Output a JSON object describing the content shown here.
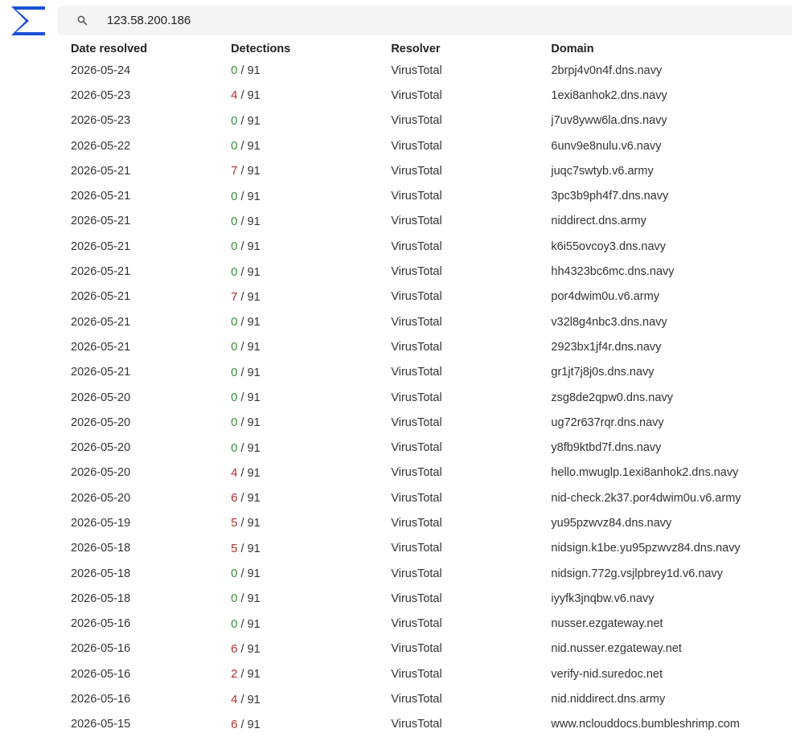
{
  "colors": {
    "accent": "#1a4fd6",
    "detections_clean": "#3d8f3d",
    "detections_flagged": "#b03030"
  },
  "search": {
    "value": "123.58.200.186",
    "icon": "search-icon"
  },
  "table": {
    "headers": [
      "Date resolved",
      "Detections",
      "Resolver",
      "Domain"
    ],
    "detections_total": "/ 91",
    "rows": [
      {
        "date": "2026-05-24",
        "detections": "0",
        "resolver": "VirusTotal",
        "domain": "2brpj4v0n4f.dns.navy"
      },
      {
        "date": "2026-05-23",
        "detections": "4",
        "resolver": "VirusTotal",
        "domain": "1exi8anhok2.dns.navy"
      },
      {
        "date": "2026-05-23",
        "detections": "0",
        "resolver": "VirusTotal",
        "domain": "j7uv8yww6la.dns.navy"
      },
      {
        "date": "2026-05-22",
        "detections": "0",
        "resolver": "VirusTotal",
        "domain": "6unv9e8nulu.v6.navy"
      },
      {
        "date": "2026-05-21",
        "detections": "7",
        "resolver": "VirusTotal",
        "domain": "juqc7swtyb.v6.army"
      },
      {
        "date": "2026-05-21",
        "detections": "0",
        "resolver": "VirusTotal",
        "domain": "3pc3b9ph4f7.dns.navy"
      },
      {
        "date": "2026-05-21",
        "detections": "0",
        "resolver": "VirusTotal",
        "domain": "niddirect.dns.army"
      },
      {
        "date": "2026-05-21",
        "detections": "0",
        "resolver": "VirusTotal",
        "domain": "k6i55ovcoy3.dns.navy"
      },
      {
        "date": "2026-05-21",
        "detections": "0",
        "resolver": "VirusTotal",
        "domain": "hh4323bc6mc.dns.navy"
      },
      {
        "date": "2026-05-21",
        "detections": "7",
        "resolver": "VirusTotal",
        "domain": "por4dwim0u.v6.army"
      },
      {
        "date": "2026-05-21",
        "detections": "0",
        "resolver": "VirusTotal",
        "domain": "v32l8g4nbc3.dns.navy"
      },
      {
        "date": "2026-05-21",
        "detections": "0",
        "resolver": "VirusTotal",
        "domain": "2923bx1jf4r.dns.navy"
      },
      {
        "date": "2026-05-21",
        "detections": "0",
        "resolver": "VirusTotal",
        "domain": "gr1jt7j8j0s.dns.navy"
      },
      {
        "date": "2026-05-20",
        "detections": "0",
        "resolver": "VirusTotal",
        "domain": "zsg8de2qpw0.dns.navy"
      },
      {
        "date": "2026-05-20",
        "detections": "0",
        "resolver": "VirusTotal",
        "domain": "ug72r637rqr.dns.navy"
      },
      {
        "date": "2026-05-20",
        "detections": "0",
        "resolver": "VirusTotal",
        "domain": "y8fb9ktbd7f.dns.navy"
      },
      {
        "date": "2026-05-20",
        "detections": "4",
        "resolver": "VirusTotal",
        "domain": "hello.mwuglp.1exi8anhok2.dns.navy"
      },
      {
        "date": "2026-05-20",
        "detections": "6",
        "resolver": "VirusTotal",
        "domain": "nid-check.2k37.por4dwim0u.v6.army"
      },
      {
        "date": "2026-05-19",
        "detections": "5",
        "resolver": "VirusTotal",
        "domain": "yu95pzwvz84.dns.navy"
      },
      {
        "date": "2026-05-18",
        "detections": "5",
        "resolver": "VirusTotal",
        "domain": "nidsign.k1be.yu95pzwvz84.dns.navy"
      },
      {
        "date": "2026-05-18",
        "detections": "0",
        "resolver": "VirusTotal",
        "domain": "nidsign.772g.vsjlpbrey1d.v6.navy"
      },
      {
        "date": "2026-05-18",
        "detections": "0",
        "resolver": "VirusTotal",
        "domain": "iyyfk3jnqbw.v6.navy"
      },
      {
        "date": "2026-05-16",
        "detections": "0",
        "resolver": "VirusTotal",
        "domain": "nusser.ezgateway.net"
      },
      {
        "date": "2026-05-16",
        "detections": "6",
        "resolver": "VirusTotal",
        "domain": "nid.nusser.ezgateway.net"
      },
      {
        "date": "2026-05-16",
        "detections": "2",
        "resolver": "VirusTotal",
        "domain": "verify-nid.suredoc.net"
      },
      {
        "date": "2026-05-16",
        "detections": "4",
        "resolver": "VirusTotal",
        "domain": "nid.niddirect.dns.army"
      },
      {
        "date": "2026-05-15",
        "detections": "6",
        "resolver": "VirusTotal",
        "domain": "www.nclouddocs.bumbleshrimp.com"
      }
    ]
  }
}
